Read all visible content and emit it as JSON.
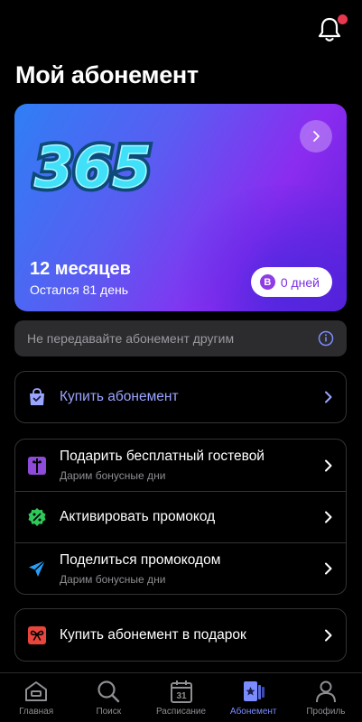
{
  "header": {
    "title": "Мой абонемент",
    "notification_dot": true
  },
  "subscription_card": {
    "logo_text": "365",
    "period": "12 месяцев",
    "remaining": "Остался 81 день",
    "bonus_badge_letter": "B",
    "bonus_days": "0 дней"
  },
  "notice": {
    "text": "Не передавайте абонемент другим",
    "icon": "info-icon"
  },
  "buy": {
    "label": "Купить абонемент",
    "icon": "shopping-bag-icon"
  },
  "actions": [
    {
      "label": "Подарить бесплатный гостевой",
      "sub": "Дарим бонусные дни",
      "icon": "gift-icon"
    },
    {
      "label": "Активировать промокод",
      "icon": "promo-percent-icon"
    },
    {
      "label": "Поделиться промокодом",
      "sub": "Дарим бонусные дни",
      "icon": "send-icon"
    }
  ],
  "gift": {
    "label": "Купить абонемент в подарок",
    "icon": "bow-icon"
  },
  "tabs": [
    {
      "label": "Главная",
      "icon": "home-icon"
    },
    {
      "label": "Поиск",
      "icon": "search-icon"
    },
    {
      "label": "Расписание",
      "icon": "calendar-icon",
      "badge": "31"
    },
    {
      "label": "Абонемент",
      "icon": "membership-card-icon",
      "active": true
    },
    {
      "label": "Профиль",
      "icon": "profile-icon"
    }
  ],
  "colors": {
    "accent": "#7b8cff",
    "card_start": "#2f7ff5",
    "card_end": "#8b2cf0",
    "notification": "#e8384f"
  }
}
